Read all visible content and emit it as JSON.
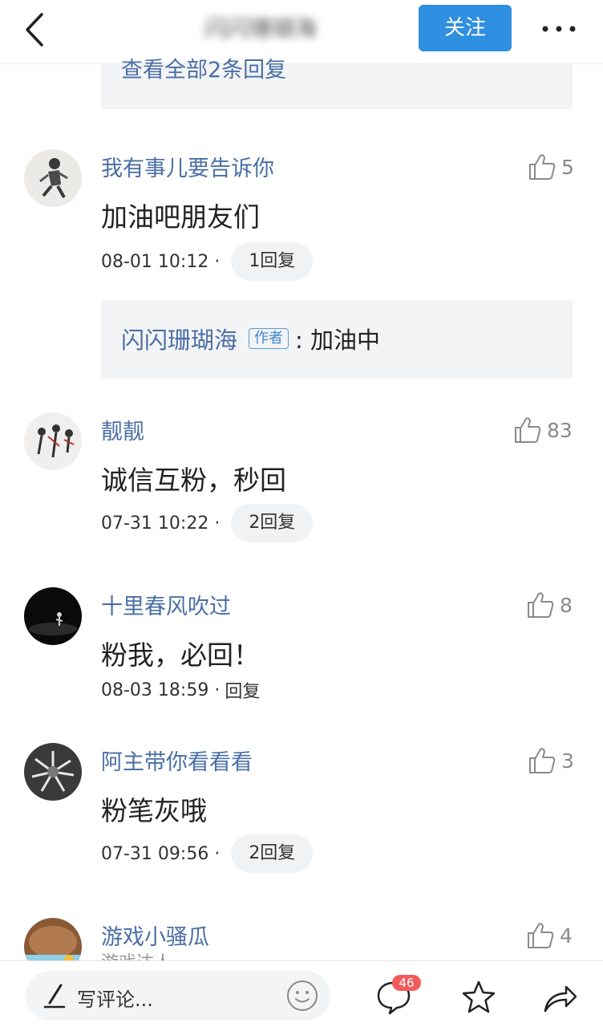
{
  "header": {
    "title": "闪闪珊瑚海",
    "follow_label": "关注"
  },
  "replies_more": {
    "label": "查看全部2条回复"
  },
  "comments": [
    {
      "name": "我有事儿要告诉你",
      "text": "加油吧朋友们",
      "time": "08-01 10:12 ·",
      "reply_label": "1回复",
      "likes": "5",
      "author_reply": {
        "name": "闪闪珊瑚海",
        "tag": "作者",
        "text": ": 加油中"
      }
    },
    {
      "name": "靓靓",
      "text": "诚信互粉，秒回",
      "time": "07-31 10:22 ·",
      "reply_label": "2回复",
      "likes": "83"
    },
    {
      "name": "十里春风吹过",
      "text": "粉我，必回！",
      "time": "08-03 18:59 ·",
      "reply_label": "回复",
      "likes": "8"
    },
    {
      "name": "阿主带你看看看",
      "text": "粉笔灰哦",
      "time": "07-31 09:56 ·",
      "reply_label": "2回复",
      "likes": "3"
    },
    {
      "name": "游戏小骚瓜",
      "subtitle": "游戏达人",
      "likes": "4"
    }
  ],
  "bottom_bar": {
    "input_placeholder": "写评论...",
    "comment_badge": "46"
  },
  "icons": {
    "back": "chevron-left-icon",
    "more": "more-dots-icon",
    "like": "thumbs-up-icon",
    "pencil": "pencil-icon",
    "emoji": "smiley-icon",
    "comments": "chat-bubble-icon",
    "favorite": "star-icon",
    "share": "share-arrow-icon"
  },
  "colors": {
    "accent": "#2f8fe0",
    "username": "#4a6fa5",
    "badge": "#f25a5a"
  }
}
